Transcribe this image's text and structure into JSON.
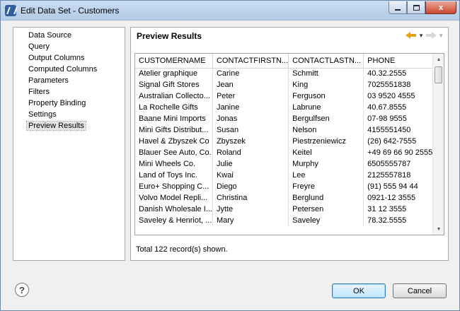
{
  "window": {
    "title": "Edit Data Set - Customers",
    "minimize_label": "",
    "maximize_label": "",
    "close_label": "x"
  },
  "colors": {
    "titlebar": "#b3cbe6",
    "close_button": "#c9462f",
    "back_arrow": "#e2a316",
    "ok_button": "#bee6fd"
  },
  "icons": {
    "app": "birt-app-icon",
    "back": "back-arrow-icon",
    "forward": "forward-arrow-icon",
    "help": "help-icon"
  },
  "sidebar": {
    "items": [
      {
        "label": "Data Source",
        "selected": false
      },
      {
        "label": "Query",
        "selected": false
      },
      {
        "label": "Output Columns",
        "selected": false
      },
      {
        "label": "Computed Columns",
        "selected": false
      },
      {
        "label": "Parameters",
        "selected": false
      },
      {
        "label": "Filters",
        "selected": false
      },
      {
        "label": "Property Binding",
        "selected": false
      },
      {
        "label": "Settings",
        "selected": false
      },
      {
        "label": "Preview Results",
        "selected": true
      }
    ]
  },
  "main": {
    "title": "Preview Results",
    "help_symbol": "?",
    "table": {
      "columns": [
        "CUSTOMERNAME",
        "CONTACTFIRSTN...",
        "CONTACTLASTN...",
        "PHONE"
      ],
      "rows": [
        [
          "Atelier graphique",
          "Carine",
          "Schmitt",
          "40.32.2555"
        ],
        [
          "Signal Gift Stores",
          "Jean",
          "King",
          "7025551838"
        ],
        [
          "Australian Collecto...",
          "Peter",
          "Ferguson",
          "03 9520 4555"
        ],
        [
          "La Rochelle Gifts",
          "Janine",
          "Labrune",
          "40.67.8555"
        ],
        [
          "Baane Mini Imports",
          "Jonas",
          "Bergulfsen",
          "07-98 9555"
        ],
        [
          "Mini Gifts Distribut...",
          "Susan",
          "Nelson",
          "4155551450"
        ],
        [
          "Havel & Zbyszek Co",
          "Zbyszek",
          "Piestrzeniewicz",
          "(26) 642-7555"
        ],
        [
          "Blauer See Auto, Co.",
          "Roland",
          "Keitel",
          "+49 69 66 90 2555"
        ],
        [
          "Mini Wheels Co.",
          "Julie",
          "Murphy",
          "6505555787"
        ],
        [
          "Land of Toys Inc.",
          "Kwai",
          "Lee",
          "2125557818"
        ],
        [
          "Euro+ Shopping C...",
          "Diego",
          "Freyre",
          "(91) 555 94 44"
        ],
        [
          "Volvo Model Repli...",
          "Christina",
          "Berglund",
          "0921-12 3555"
        ],
        [
          "Danish Wholesale I...",
          "Jytte",
          "Petersen",
          "31 12 3555"
        ],
        [
          "Saveley & Henriot, ...",
          "Mary",
          "Saveley",
          "78.32.5555"
        ]
      ]
    },
    "status": "Total 122 record(s) shown."
  },
  "buttons": {
    "ok": "OK",
    "cancel": "Cancel"
  }
}
